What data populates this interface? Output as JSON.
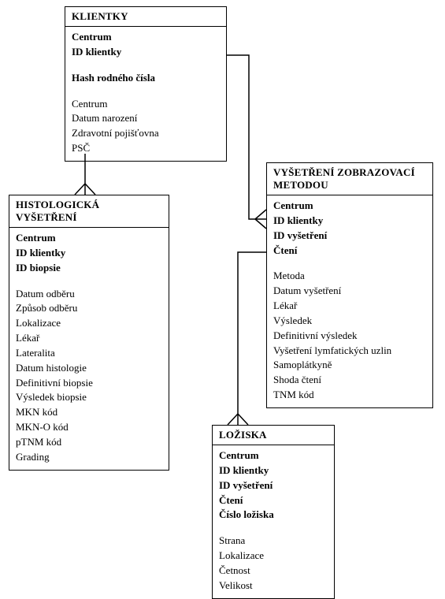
{
  "entities": {
    "klientky": {
      "title": "KLIENTKY",
      "keys": [
        "Centrum",
        "ID klientky"
      ],
      "specialKeys": [
        "Hash rodného čísla"
      ],
      "attrs": [
        "Centrum",
        "Datum narození",
        "Zdravotní pojišťovna",
        "PSČ"
      ]
    },
    "histologicka": {
      "title": "HISTOLOGICKÁ VYŠETŘENÍ",
      "keys": [
        "Centrum",
        "ID klientky",
        "ID biopsie"
      ],
      "attrs": [
        "Datum odběru",
        "Způsob odběru",
        "Lokalizace",
        "Lékař",
        "Lateralita",
        "Datum histologie",
        "Definitivní biopsie",
        "Výsledek biopsie",
        "MKN kód",
        "MKN-O kód",
        "pTNM kód",
        "Grading"
      ]
    },
    "vysetreni": {
      "title": "VYŠETŘENÍ ZOBRAZOVACÍ METODOU",
      "keys": [
        "Centrum",
        "ID klientky",
        "ID vyšetření",
        "Čtení"
      ],
      "attrs": [
        "Metoda",
        "Datum vyšetření",
        "Lékař",
        "Výsledek",
        "Definitivní výsledek",
        "Vyšetření lymfatických uzlin",
        "Samoplátkyně",
        "Shoda čtení",
        "TNM kód"
      ]
    },
    "loziska": {
      "title": "LOŽISKA",
      "keys": [
        "Centrum",
        "ID klientky",
        "ID vyšetření",
        "Čtení",
        "Číslo ložiska"
      ],
      "attrs": [
        "Strana",
        "Lokalizace",
        "Četnost",
        "Velikost"
      ]
    }
  }
}
